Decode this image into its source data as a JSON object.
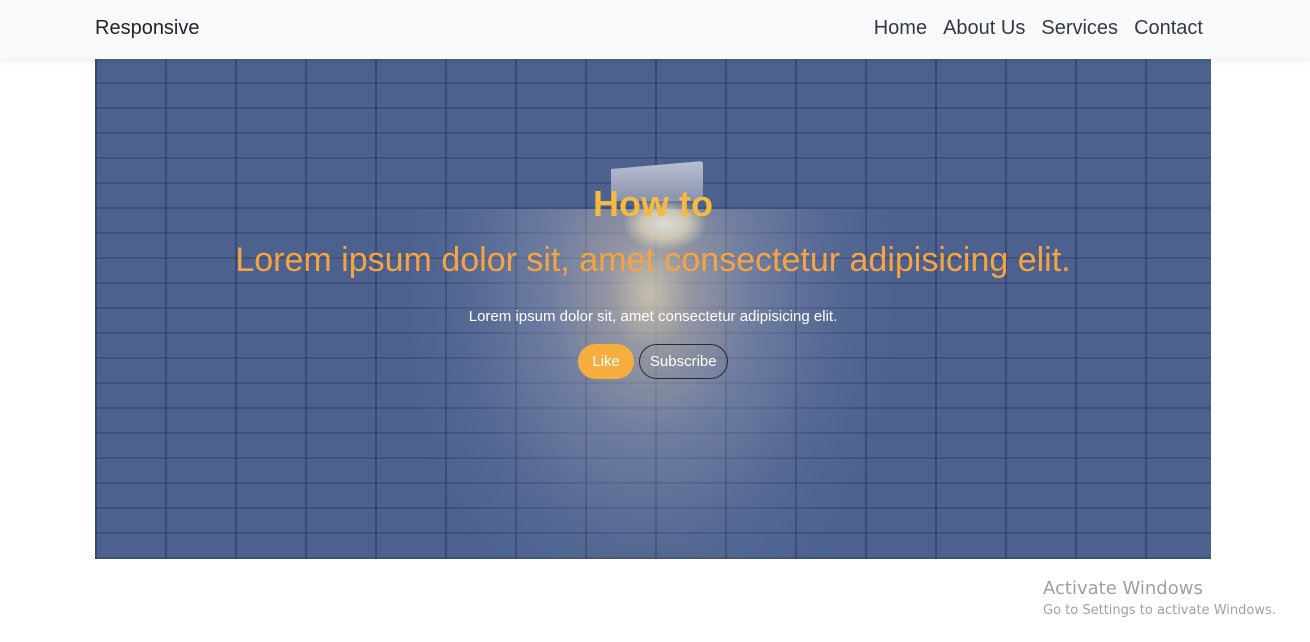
{
  "navbar": {
    "brand": "Responsive",
    "links": [
      {
        "label": "Home"
      },
      {
        "label": "About Us"
      },
      {
        "label": "Services"
      },
      {
        "label": "Contact"
      }
    ],
    "background": "#f8f9fa"
  },
  "hero": {
    "title": "How to",
    "subtitle": "Lorem ipsum dolor sit, amet consectetur adipisicing elit.",
    "text": "Lorem ipsum dolor sit, amet consectetur adipisicing elit.",
    "like_button": "Like",
    "subscribe_button": "Subscribe",
    "colors": {
      "title": "#f6ba3f",
      "subtitle": "#f7a440",
      "like_bg": "#f6ae3e",
      "background": "#506692"
    }
  },
  "watermark": {
    "title": "Activate Windows",
    "subtitle": "Go to Settings to activate Windows."
  }
}
